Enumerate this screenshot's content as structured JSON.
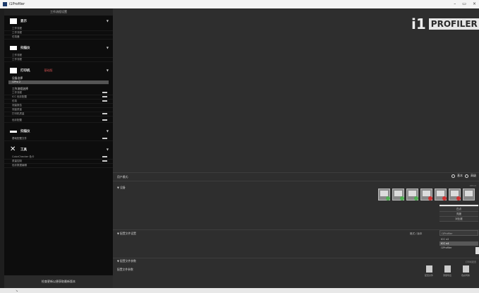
{
  "window": {
    "title": "i1Profiler",
    "controls": [
      "–",
      "▭",
      "×"
    ]
  },
  "sidebar": {
    "header": "工作流程设置",
    "sections": [
      {
        "label": "显示",
        "items": [
          "工作流程",
          "工作流程",
          "仿真器"
        ]
      },
      {
        "label": "扫描仪",
        "items": [
          "工作流程",
          "工作流程"
        ]
      },
      {
        "label": "打印机",
        "note": "基础版",
        "device_label": "设备选择",
        "device_value": "i1Pro 2",
        "group_label": "工作流程选择",
        "items": [
          "工作流程",
          "ICC 色彩配置",
          "仿真",
          "测量报告",
          "测量质量",
          "打印机质量",
          "色彩配置",
          "颜色校准配置"
        ]
      },
      {
        "label": "扫描仪",
        "items": [
          "基础配置文件"
        ]
      },
      {
        "label": "工具",
        "items": [
          "ColorChecker 色卡",
          "质量控制",
          "色彩数据编辑"
        ]
      }
    ],
    "footer": "检查更新以便获取最新版本"
  },
  "main": {
    "logo_i1": "i1",
    "logo_profiler": "PROFILER",
    "user_mode_label": "用户模式:",
    "user_mode_opts": [
      "基本",
      "高级"
    ],
    "section_1": "▼ 设备",
    "light_info": "i1Pro2",
    "section_2": "▼ 配置文件设置",
    "section_3": "▼ 配置文件参数",
    "section_4": "配置文件参数",
    "profile_label": "格式 / 版本",
    "profile_select": "i1Profiler",
    "profile_list": [
      "ICC v2",
      "ICC v4",
      "i1Profiler"
    ],
    "menu_items": [
      "白点",
      "亮度",
      "对比度"
    ],
    "bottom_info": "打印机配置",
    "actions": [
      "配置文件",
      "测量导出",
      "色彩转换"
    ]
  }
}
